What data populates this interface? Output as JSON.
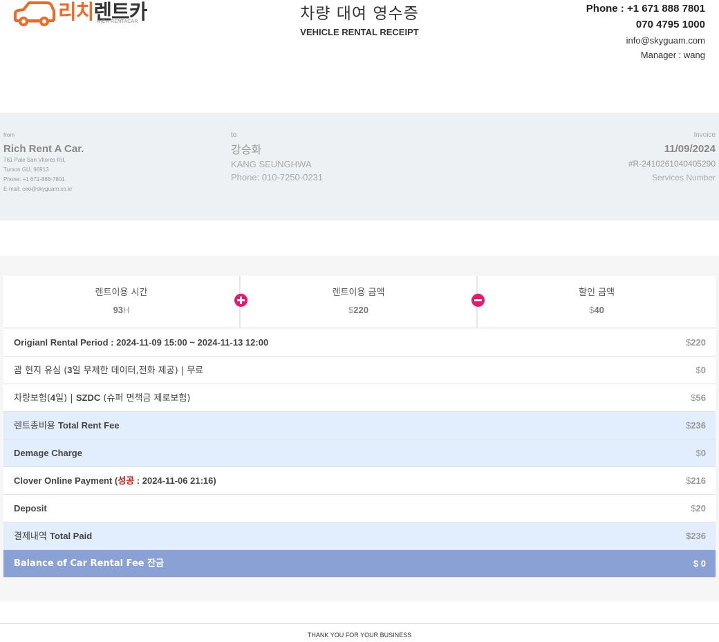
{
  "header": {
    "logo": {
      "brand_ko_1": "리치",
      "brand_ko_2": "렌트카",
      "brand_en": "RICH RENTACAR"
    },
    "title_ko": "차량 대여 영수증",
    "title_en": "VEHICLE RENTAL RECEIPT",
    "contact": {
      "phone1": "Phone : +1 671 888 7801",
      "phone2": "070 4795 1000",
      "email": "info@skyguam.com",
      "manager": "Manager : wang"
    }
  },
  "billing": {
    "from": {
      "label": "from",
      "name": "Rich Rent A Car.",
      "address1": "761 Pale San Vitores Rd,",
      "address2": "Tumon GU, 96913",
      "phone": "Phone: +1 671-888-7801",
      "email": "E-mail: ceo@skyguam.co.kr"
    },
    "to": {
      "label": "to",
      "name_ko": "강승화",
      "name_en": "KANG SEUNGHWA",
      "phone": "Phone: 010-7250-0231"
    },
    "invoice": {
      "label": "Invoice",
      "date": "11/09/2024",
      "number": "#R-2410261040405290",
      "services_label": "Services Number"
    }
  },
  "summary": {
    "rental_time": {
      "label": "렌트이용 시간",
      "value": "93",
      "unit": "H"
    },
    "rental_amount": {
      "label": "렌트이용 금액",
      "currency": "$",
      "value": "220"
    },
    "discount": {
      "label": "할인 금액",
      "currency": "$",
      "value": "40"
    }
  },
  "line_items": {
    "original_period": {
      "label": "Origianl Rental Period : 2024-11-09 15:00 ~ 2024-11-13 12:00",
      "currency": "$",
      "amount": "220"
    },
    "sim": {
      "label_pre": "괌 현지 유심 (",
      "label_bold": "3",
      "label_post": "일 무제한 데이터,전화 제공) | 무료",
      "currency": "$",
      "amount": "0"
    },
    "insurance": {
      "label_pre": "차량보험(",
      "label_bold": "4",
      "label_mid": "일) | ",
      "label_bold2": "SZDC",
      "label_post": " (슈퍼 면책금 제로보험)",
      "currency": "$",
      "amount": "56"
    },
    "total_rent_fee": {
      "label_ko": "렌트총비용",
      "label_en": "Total Rent Fee",
      "currency": "$",
      "amount": "236"
    },
    "damage_charge": {
      "label": "Demage Charge",
      "currency": "$",
      "amount": "0"
    },
    "clover_payment": {
      "label_pre": "Clover Online Payment (",
      "status": "성공",
      "label_post": " : 2024-11-06 21:16)",
      "currency": "$",
      "amount": "216"
    },
    "deposit": {
      "label": "Deposit",
      "currency": "$",
      "amount": "20"
    },
    "total_paid": {
      "label_ko": "결제내역",
      "label_en": "Total Paid",
      "amount": "$236"
    },
    "balance": {
      "label": "Balance of Car Rental Fee 잔금",
      "currency": "$",
      "amount": "0"
    }
  },
  "footer": {
    "text": "THANK YOU FOR YOUR BUSINESS"
  },
  "colors": {
    "brand_orange": "#ee6a2a",
    "accent_pink": "#e8186d",
    "row_blue": "#e2eefd",
    "balance_row": "#8aa1d5",
    "status_red": "#d01010"
  }
}
